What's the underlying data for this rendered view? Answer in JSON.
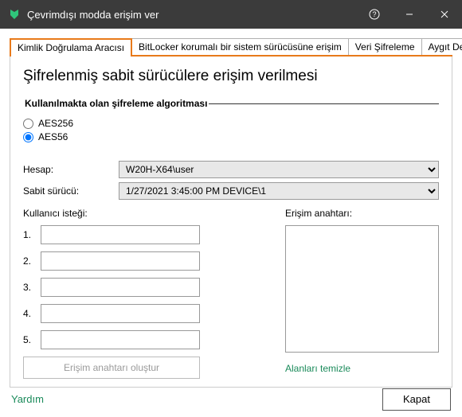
{
  "window": {
    "title": "Çevrimdışı modda erişim ver"
  },
  "tabs": {
    "t0": "Kimlik Doğrulama Aracısı",
    "t1": "BitLocker korumalı bir sistem sürücüsüne erişim",
    "t2": "Veri Şifreleme",
    "t3": "Aygıt De"
  },
  "pane": {
    "title": "Şifrelenmiş sabit sürücülere erişim verilmesi"
  },
  "algo": {
    "legend": "Kullanılmakta olan şifreleme algoritması",
    "opt1": "AES256",
    "opt2": "AES56"
  },
  "account": {
    "label": "Hesap:",
    "value": "W20H-X64\\user"
  },
  "drive": {
    "label": "Sabit sürücü:",
    "value": "1/27/2021 3:45:00 PM  DEVICE\\1"
  },
  "request": {
    "label": "Kullanıcı isteği:",
    "n1": "1.",
    "n2": "2.",
    "n3": "3.",
    "n4": "4.",
    "n5": "5.",
    "generate": "Erişim anahtarı oluştur"
  },
  "key": {
    "label": "Erişim anahtarı:",
    "clear": "Alanları temizle"
  },
  "footer": {
    "help": "Yardım",
    "close": "Kapat"
  }
}
